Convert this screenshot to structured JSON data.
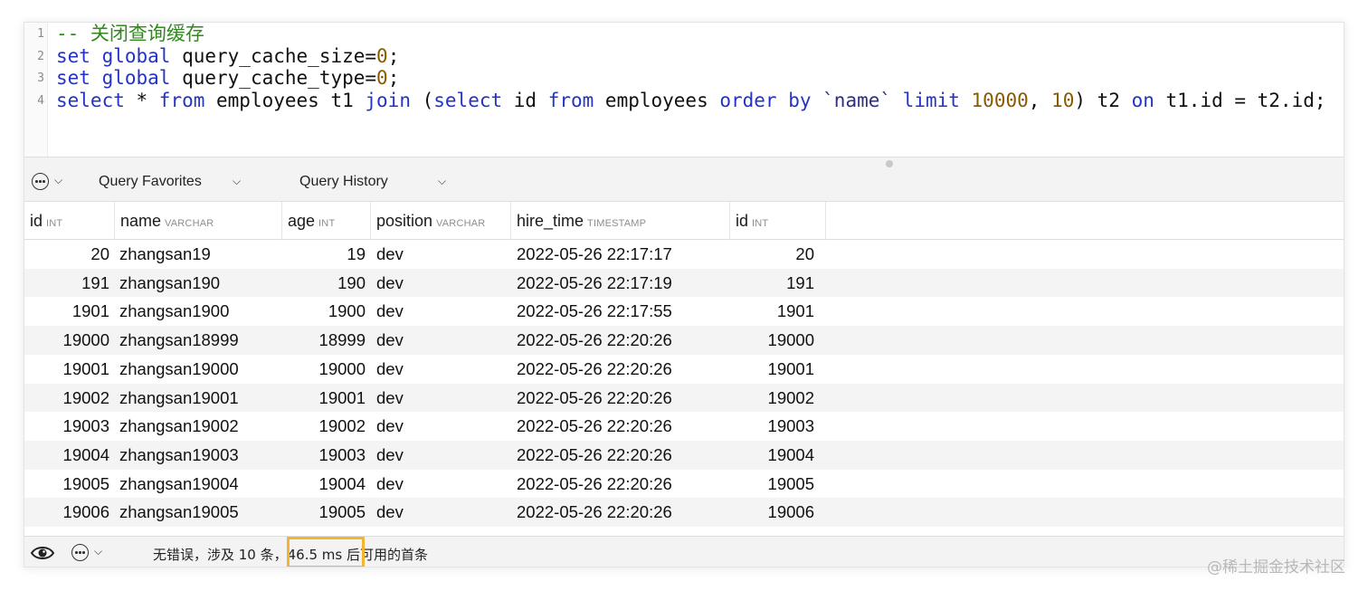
{
  "editor": {
    "lines": [
      {
        "num": "1",
        "comment": "-- 关闭查询缓存"
      },
      {
        "num": "2",
        "kw1": "set",
        "kw2": "global",
        "text": " query_cache_size=",
        "val": "0",
        "end": ";"
      },
      {
        "num": "3",
        "kw1": "set",
        "kw2": "global",
        "text": " query_cache_type=",
        "val": "0",
        "end": ";"
      },
      {
        "num": "4",
        "t_select": "select",
        "t_star": " * ",
        "t_from": "from",
        "t_emp": " employees t1 ",
        "t_join": "join",
        "t_paren": " (",
        "t_select2": "select",
        "t_id": " id ",
        "t_from2": "from",
        "t_emp2": " employees ",
        "t_order": "order by",
        "t_name": " `name` ",
        "t_limit": "limit",
        "t_n1": " 10000",
        "t_comma": ", ",
        "t_n2": "10",
        "t_close": ") t2 ",
        "t_on": "on",
        "t_cond": " t1.id = t2.id;"
      }
    ]
  },
  "toolbar": {
    "favorites_label": "Query Favorites",
    "history_label": "Query History"
  },
  "grid": {
    "columns": [
      {
        "name": "id",
        "type": "INT"
      },
      {
        "name": "name",
        "type": "VARCHAR"
      },
      {
        "name": "age",
        "type": "INT"
      },
      {
        "name": "position",
        "type": "VARCHAR"
      },
      {
        "name": "hire_time",
        "type": "TIMESTAMP"
      },
      {
        "name": "id",
        "type": "INT"
      }
    ],
    "rows": [
      [
        "20",
        "zhangsan19",
        "19",
        "dev",
        "2022-05-26 22:17:17",
        "20"
      ],
      [
        "191",
        "zhangsan190",
        "190",
        "dev",
        "2022-05-26 22:17:19",
        "191"
      ],
      [
        "1901",
        "zhangsan1900",
        "1900",
        "dev",
        "2022-05-26 22:17:55",
        "1901"
      ],
      [
        "19000",
        "zhangsan18999",
        "18999",
        "dev",
        "2022-05-26 22:20:26",
        "19000"
      ],
      [
        "19001",
        "zhangsan19000",
        "19000",
        "dev",
        "2022-05-26 22:20:26",
        "19001"
      ],
      [
        "19002",
        "zhangsan19001",
        "19001",
        "dev",
        "2022-05-26 22:20:26",
        "19002"
      ],
      [
        "19003",
        "zhangsan19002",
        "19002",
        "dev",
        "2022-05-26 22:20:26",
        "19003"
      ],
      [
        "19004",
        "zhangsan19003",
        "19003",
        "dev",
        "2022-05-26 22:20:26",
        "19004"
      ],
      [
        "19005",
        "zhangsan19004",
        "19004",
        "dev",
        "2022-05-26 22:20:26",
        "19005"
      ],
      [
        "19006",
        "zhangsan19005",
        "19005",
        "dev",
        "2022-05-26 22:20:26",
        "19006"
      ]
    ]
  },
  "status": {
    "text": "无错误，涉及 10 条，46.5 ms 后可用的首条"
  },
  "watermark": "@稀土掘金技术社区",
  "colors": {
    "keyword": "#2433c7",
    "number": "#8a5a00",
    "comment": "#2f8a1b",
    "highlight": "#f2b530"
  },
  "icons": [
    "more-circle-icon",
    "chevron-down-icon",
    "eye-icon"
  ]
}
